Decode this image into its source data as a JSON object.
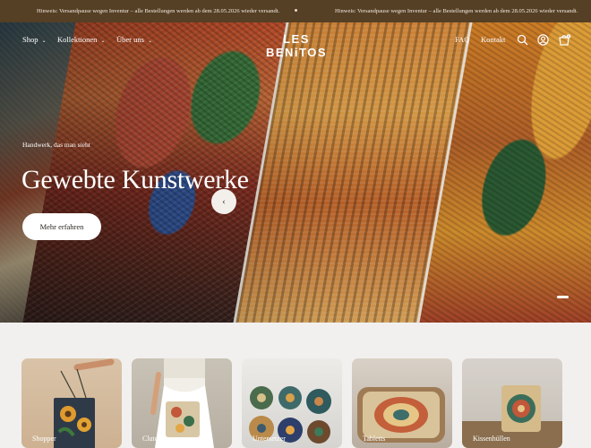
{
  "announcement": {
    "messages": [
      "Hinweis: Versandpause wegen Inventur – alle Bestellungen werden ab dem 28.05.2026 wieder versandt.",
      "Hinweis: Versandpause wegen Inventur – alle Bestellungen werden ab dem 28.05.2026 wieder versandt."
    ],
    "background": "#553f25"
  },
  "header": {
    "nav_left": [
      {
        "label": "Shop",
        "has_dropdown": true
      },
      {
        "label": "Kollektionen",
        "has_dropdown": true
      },
      {
        "label": "Über uns",
        "has_dropdown": true
      }
    ],
    "logo": "LES BENiTOS",
    "nav_right": [
      {
        "label": "FAQ"
      },
      {
        "label": "Kontakt"
      }
    ],
    "icons": [
      "search-icon",
      "account-icon",
      "cart-icon"
    ],
    "cart_count": "0"
  },
  "hero": {
    "subtitle": "Handwerk, das man sieht",
    "title": "Gewebte Kunstwerke",
    "cta": "Mehr erfahren",
    "prev_icon": "‹"
  },
  "categories": [
    {
      "label": "Shopper"
    },
    {
      "label": "Clutches"
    },
    {
      "label": "Untersetzer"
    },
    {
      "label": "Tabletts"
    },
    {
      "label": "Kissenhüllen"
    }
  ]
}
